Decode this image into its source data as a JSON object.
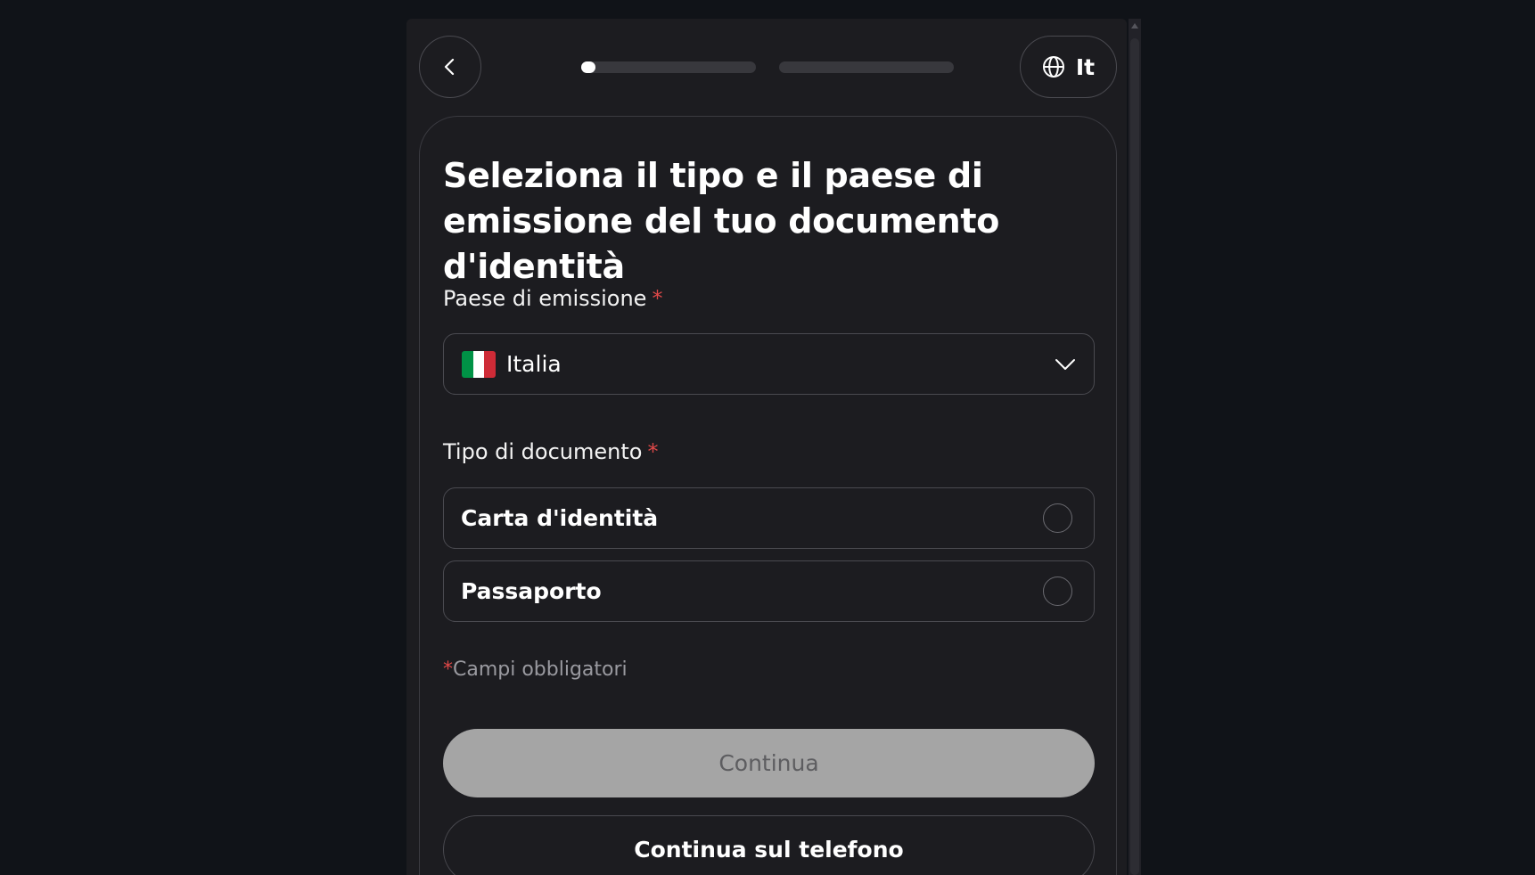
{
  "header": {
    "back_icon": "chevron-left-icon",
    "progress": [
      {
        "step": 1,
        "fill": 0.08
      },
      {
        "step": 2,
        "fill": 0
      }
    ],
    "language": {
      "icon": "globe-icon",
      "label": "It"
    }
  },
  "form": {
    "title": "Seleziona il tipo e il paese di emissione del tuo documento d'identità",
    "country": {
      "label": "Paese di emissione",
      "required_mark": "*",
      "value": "Italia",
      "flag_colors": [
        "#009246",
        "#ffffff",
        "#ce2b37"
      ],
      "chevron_icon": "chevron-down-icon"
    },
    "document_type": {
      "label": "Tipo di documento",
      "required_mark": "*",
      "options": [
        {
          "label": "Carta d'identità",
          "selected": false
        },
        {
          "label": "Passaporto",
          "selected": false
        }
      ]
    },
    "required_note": {
      "mark": "*",
      "text": "Campi obbligatori"
    },
    "continue_label": "Continua",
    "continue_phone_label": "Continua sul telefono"
  },
  "colors": {
    "background": "#101318",
    "panel": "#1c1c20",
    "required": "#e04848",
    "disabled_button": "#a5a5a5"
  }
}
